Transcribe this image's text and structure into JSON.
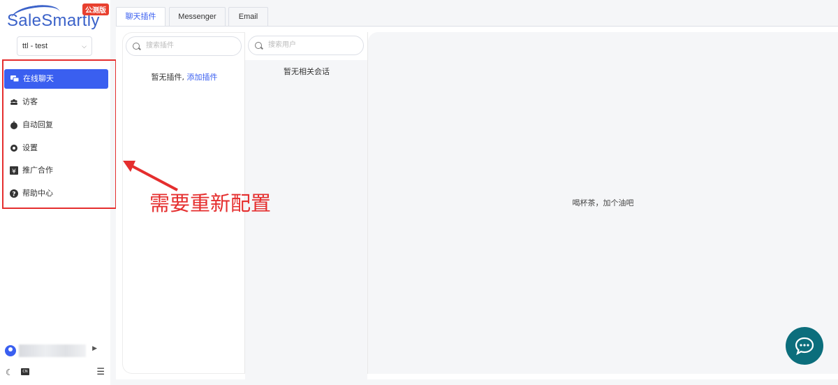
{
  "brand": {
    "name": "SaleSmartly",
    "badge": "公测版"
  },
  "workspace": {
    "selected": "ttl - test"
  },
  "nav": [
    {
      "label": "在线聊天",
      "icon": "chat-icon",
      "active": true
    },
    {
      "label": "访客",
      "icon": "visitors-icon",
      "active": false
    },
    {
      "label": "自动回复",
      "icon": "robot-icon",
      "active": false
    },
    {
      "label": "设置",
      "icon": "settings-icon",
      "active": false
    },
    {
      "label": "推广合作",
      "icon": "yuan-icon",
      "active": false
    },
    {
      "label": "帮助中心",
      "icon": "help-icon",
      "active": false
    }
  ],
  "footer": {
    "lang_label": "CN"
  },
  "tabs": [
    {
      "label": "聊天插件",
      "active": true
    },
    {
      "label": "Messenger",
      "active": false
    },
    {
      "label": "Email",
      "active": false
    }
  ],
  "plugins_panel": {
    "search_placeholder": "搜索插件",
    "empty_text": "暂无插件,",
    "add_link": "添加插件"
  },
  "users_panel": {
    "search_placeholder": "搜索用户",
    "empty_text": "暂无相关会话"
  },
  "conversation_panel": {
    "idle_text": "喝杯茶，加个油吧"
  },
  "annotation": {
    "text": "需要重新配置",
    "color": "#e52e2e"
  },
  "colors": {
    "accent": "#3a5ff0",
    "fab": "#0c6e7c",
    "annotation": "#e52e2e"
  }
}
